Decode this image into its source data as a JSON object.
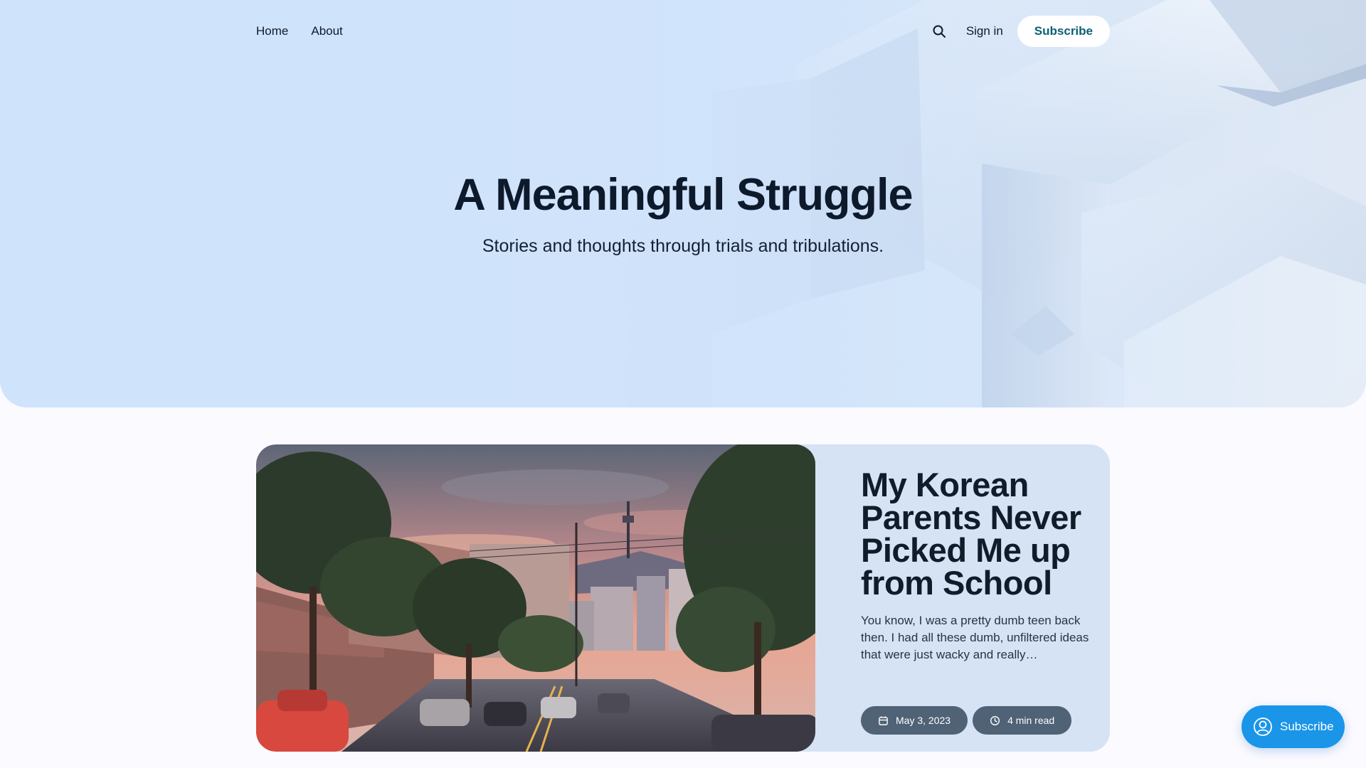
{
  "nav": {
    "links": [
      {
        "label": "Home"
      },
      {
        "label": "About"
      }
    ],
    "search_icon": "search-icon",
    "signin_label": "Sign in",
    "subscribe_label": "Subscribe"
  },
  "hero": {
    "title": "A Meaningful Struggle",
    "subtitle": "Stories and thoughts through trials and tribulations."
  },
  "featured_post": {
    "image_subject": "Seoul street at sunset with pine trees and N Seoul Tower",
    "title": "My Korean Parents Never Picked Me up from School",
    "excerpt": "You know, I was a pretty dumb teen back then. I had all these dumb, unfiltered ideas that were just wacky and really…",
    "date": "May 3, 2023",
    "read_time": "4 min read",
    "date_icon": "calendar-icon",
    "read_time_icon": "clock-icon"
  },
  "portal_button": {
    "label": "Subscribe",
    "icon": "user-circle-icon"
  },
  "colors": {
    "hero_bg": "#cfe3fb",
    "card_bg": "#d5e3f4",
    "pill_bg": "#4f6276",
    "portal_bg": "#1a95e8",
    "subscribe_text": "#0b5f75",
    "heading": "#0d1a2c"
  }
}
